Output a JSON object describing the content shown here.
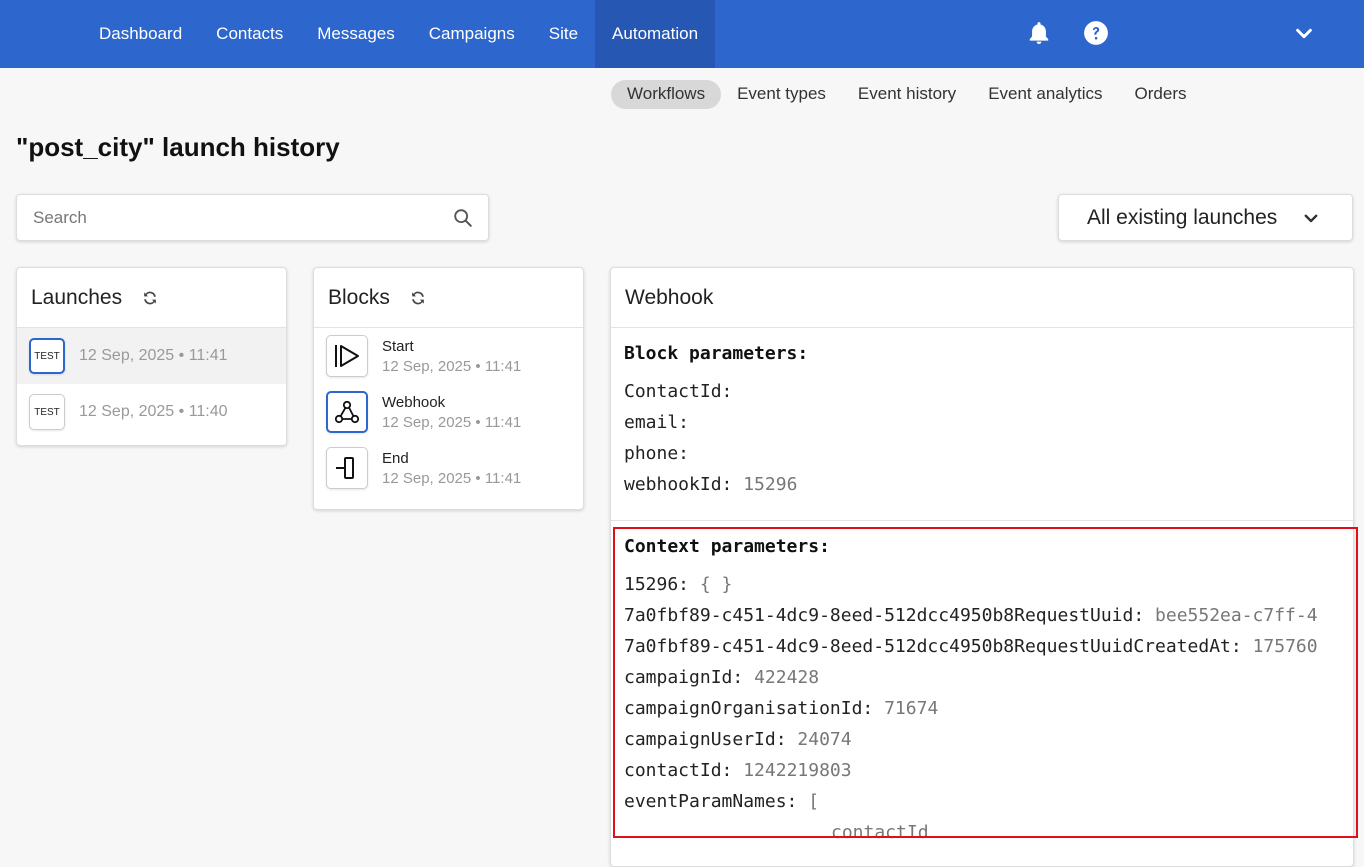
{
  "nav": {
    "items": [
      {
        "label": "Dashboard"
      },
      {
        "label": "Contacts"
      },
      {
        "label": "Messages"
      },
      {
        "label": "Campaigns"
      },
      {
        "label": "Site"
      },
      {
        "label": "Automation"
      }
    ],
    "active": "Automation",
    "icons": [
      "bell-icon",
      "help-icon",
      "chevron-down-icon"
    ],
    "accent_color": "#2d66cc"
  },
  "subnav": {
    "items": [
      {
        "label": "Workflows"
      },
      {
        "label": "Event types"
      },
      {
        "label": "Event history"
      },
      {
        "label": "Event analytics"
      },
      {
        "label": "Orders"
      }
    ],
    "active": "Workflows"
  },
  "page": {
    "title": "\"post_city\" launch history"
  },
  "search": {
    "placeholder": "Search",
    "value": ""
  },
  "filter": {
    "selected": "All existing launches"
  },
  "launches": {
    "title": "Launches",
    "items": [
      {
        "badge": "TEST",
        "time": "12 Sep, 2025 • 11:41",
        "selected": true
      },
      {
        "badge": "TEST",
        "time": "12 Sep, 2025 • 11:40",
        "selected": false
      }
    ]
  },
  "blocks": {
    "title": "Blocks",
    "items": [
      {
        "name": "Start",
        "time": "12 Sep, 2025 • 11:41",
        "icon": "start-icon"
      },
      {
        "name": "Webhook",
        "time": "12 Sep, 2025 • 11:41",
        "icon": "webhook-icon"
      },
      {
        "name": "End",
        "time": "12 Sep, 2025 • 11:41",
        "icon": "end-icon"
      }
    ]
  },
  "webhook": {
    "title": "Webhook",
    "block_params_title": "Block parameters:",
    "block_params": [
      {
        "key": "ContactId:",
        "value": ""
      },
      {
        "key": "email:",
        "value": ""
      },
      {
        "key": "phone:",
        "value": ""
      },
      {
        "key": "webhookId:",
        "value": "15296"
      }
    ],
    "context_params_title": "Context parameters:",
    "context_params": [
      {
        "key": "15296:",
        "value": "{ }"
      },
      {
        "key": "7a0fbf89-c451-4dc9-8eed-512dcc4950b8RequestUuid:",
        "value": "bee552ea-c7ff-4"
      },
      {
        "key": "7a0fbf89-c451-4dc9-8eed-512dcc4950b8RequestUuidCreatedAt:",
        "value": "175760"
      },
      {
        "key": "campaignId:",
        "value": "422428"
      },
      {
        "key": "campaignOrganisationId:",
        "value": "71674"
      },
      {
        "key": "campaignUserId:",
        "value": "24074"
      },
      {
        "key": "contactId:",
        "value": "1242219803"
      },
      {
        "key": "eventParamNames:",
        "value": "["
      }
    ],
    "context_trailing": "contactId"
  }
}
